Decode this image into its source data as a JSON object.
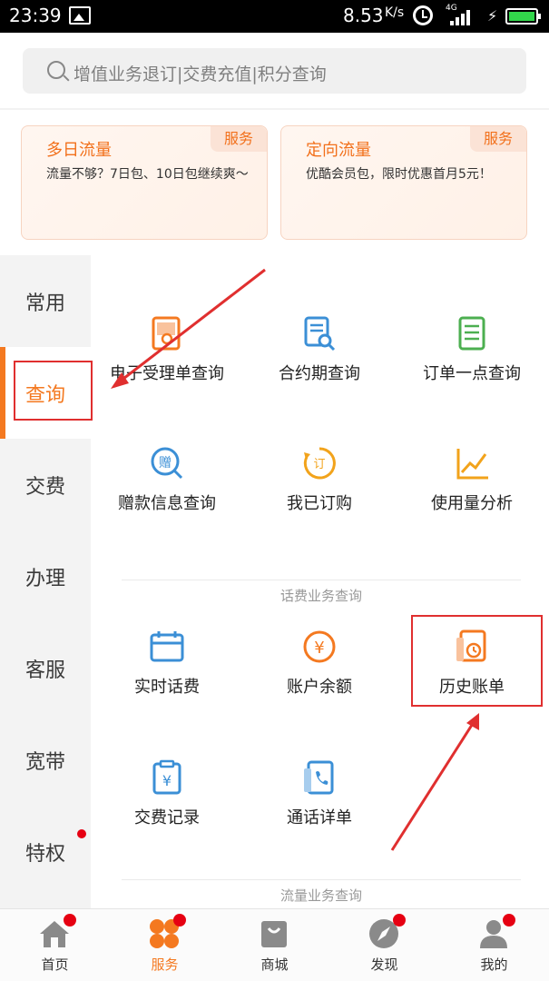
{
  "status_bar": {
    "time": "23:39",
    "speed": "8.53",
    "speed_unit": "K/s",
    "network": "4G",
    "battery_color": "#32d74b"
  },
  "search": {
    "placeholder": "增值业务退订|交费充值|积分查询",
    "icon": "search-icon"
  },
  "promo_cards": [
    {
      "title": "多日流量",
      "tag": "服务",
      "desc": "流量不够？7日包、10日包继续爽～"
    },
    {
      "title": "定向流量",
      "tag": "服务",
      "desc": "优酷会员包，限时优惠首月5元！"
    }
  ],
  "side_nav": {
    "active": "查询",
    "accent_color": "#f47920",
    "items": [
      {
        "label": "常用"
      },
      {
        "label": "查询"
      },
      {
        "label": "交费"
      },
      {
        "label": "办理"
      },
      {
        "label": "客服"
      },
      {
        "label": "宽带"
      },
      {
        "label": "特权",
        "badge": true
      }
    ]
  },
  "query_items": [
    {
      "label": "电子受理单查询",
      "icon": "receipt-icon"
    },
    {
      "label": "合约期查询",
      "icon": "document-search-icon"
    },
    {
      "label": "订单一点查询",
      "icon": "order-list-icon"
    },
    {
      "label": "赠款信息查询",
      "icon": "gift-money-icon"
    },
    {
      "label": "我已订购",
      "icon": "subscribed-icon"
    },
    {
      "label": "使用量分析",
      "icon": "trend-chart-icon"
    }
  ],
  "sections": [
    {
      "title": "话费业务查询",
      "items": [
        {
          "label": "实时话费",
          "icon": "calendar-icon"
        },
        {
          "label": "账户余额",
          "icon": "yuan-coin-icon"
        },
        {
          "label": "历史账单",
          "icon": "bill-history-icon",
          "highlighted": true
        },
        {
          "label": "交费记录",
          "icon": "payment-record-icon"
        },
        {
          "label": "通话详单",
          "icon": "call-detail-icon"
        }
      ]
    },
    {
      "title": "流量业务查询"
    }
  ],
  "tab_bar": {
    "active": "服务",
    "items": [
      {
        "label": "首页",
        "icon": "home-icon",
        "badge": true
      },
      {
        "label": "服务",
        "icon": "service-grid-icon",
        "badge": true
      },
      {
        "label": "商城",
        "icon": "shopping-bag-icon",
        "badge": false
      },
      {
        "label": "发现",
        "icon": "compass-icon",
        "badge": true
      },
      {
        "label": "我的",
        "icon": "user-icon",
        "badge": true
      }
    ]
  },
  "annotation_color": "#e02f2f"
}
